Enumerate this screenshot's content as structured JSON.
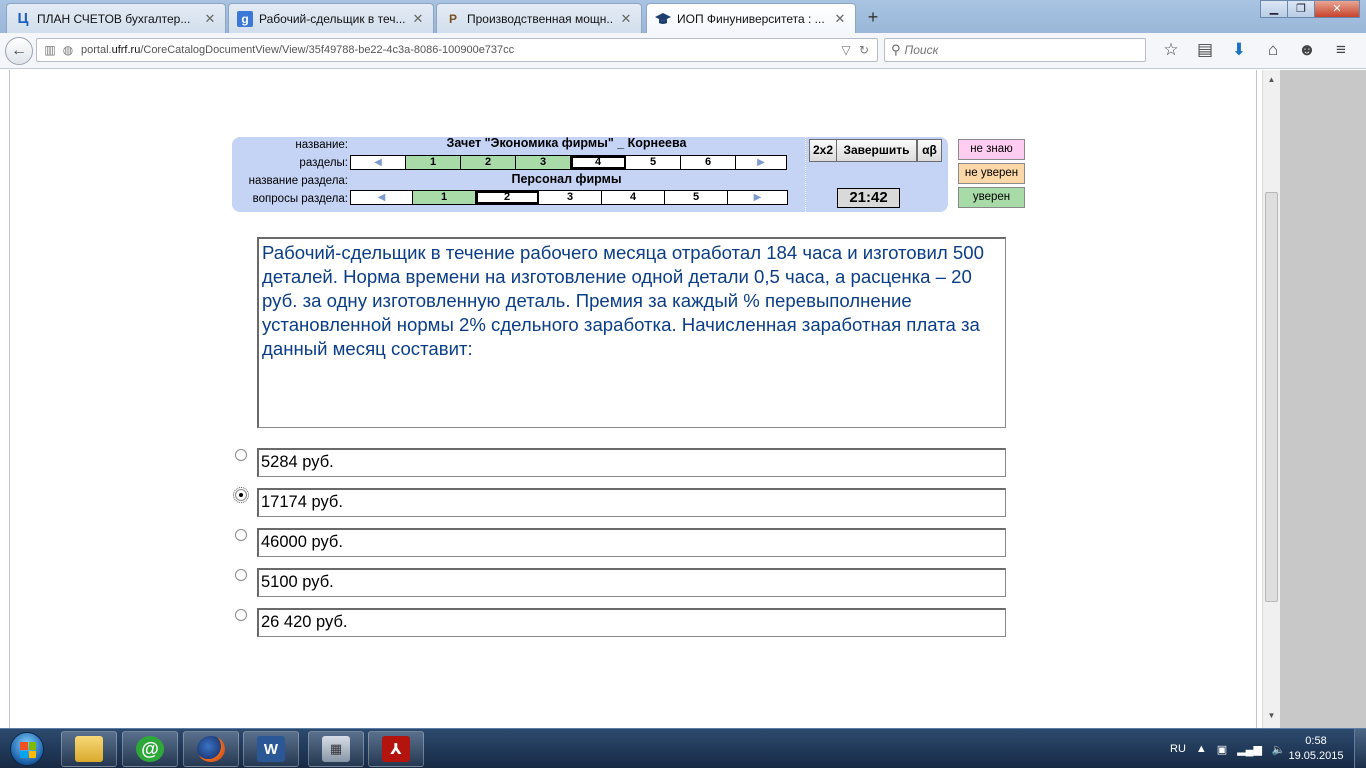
{
  "browser": {
    "tabs": [
      {
        "label": "ПЛАН СЧЕТОВ бухгалтер...",
        "icon": "Ц",
        "active": false
      },
      {
        "label": "Рабочий-сдельщик в теч...",
        "icon": "g",
        "active": false
      },
      {
        "label": "Производственная мощн...",
        "icon": "P",
        "active": false
      },
      {
        "label": "ИОП Финуниверситета : ...",
        "icon": "cap",
        "active": true
      }
    ],
    "url_prefix": "portal.",
    "url_domain": "ufrf.ru",
    "url_path": "/CoreCatalogDocumentView/View/35f49788-be22-4c3a-8086-100900e737cc",
    "search_placeholder": "Поиск"
  },
  "test": {
    "labels": {
      "name": "название:",
      "sections": "разделы:",
      "section_name": "название раздела:",
      "section_questions": "вопросы раздела:"
    },
    "title": "Зачет \"Экономика фирмы\" _ Корнеева",
    "sections": [
      "1",
      "2",
      "3",
      "4",
      "5",
      "6"
    ],
    "sections_done": [
      "1",
      "2",
      "3"
    ],
    "current_section": "4",
    "section_title": "Персонал фирмы",
    "questions": [
      "1",
      "2",
      "3",
      "4",
      "5"
    ],
    "questions_done": [
      "1"
    ],
    "current_question": "2",
    "buttons": {
      "grid": "2x2",
      "finish": "Завершить",
      "alpha": "αβ"
    },
    "timer": "21:42",
    "confidence": [
      {
        "label": "не знаю",
        "color": "#ffccf2"
      },
      {
        "label": "не уверен",
        "color": "#fcd7a7"
      },
      {
        "label": "уверен",
        "color": "#a8dba8"
      }
    ]
  },
  "question": {
    "text": "Рабочий-сдельщик в течение рабочего месяца отработал 184 часа и изготовил 500 деталей. Норма времени на изготовление одной детали 0,5 часа, а расценка – 20 руб. за одну изготовленную деталь. Премия за каждый % перевыполнение установленной нормы  2% сдельного заработка. Начисленная  заработная плата за данный месяц составит:",
    "answers": [
      "5284 руб.",
      "17174 руб.",
      "46000 руб.",
      "5100 руб.",
      "26 420 руб."
    ],
    "selected_index": 1
  },
  "taskbar": {
    "language": "RU",
    "time": "0:58",
    "date": "19.05.2015"
  }
}
